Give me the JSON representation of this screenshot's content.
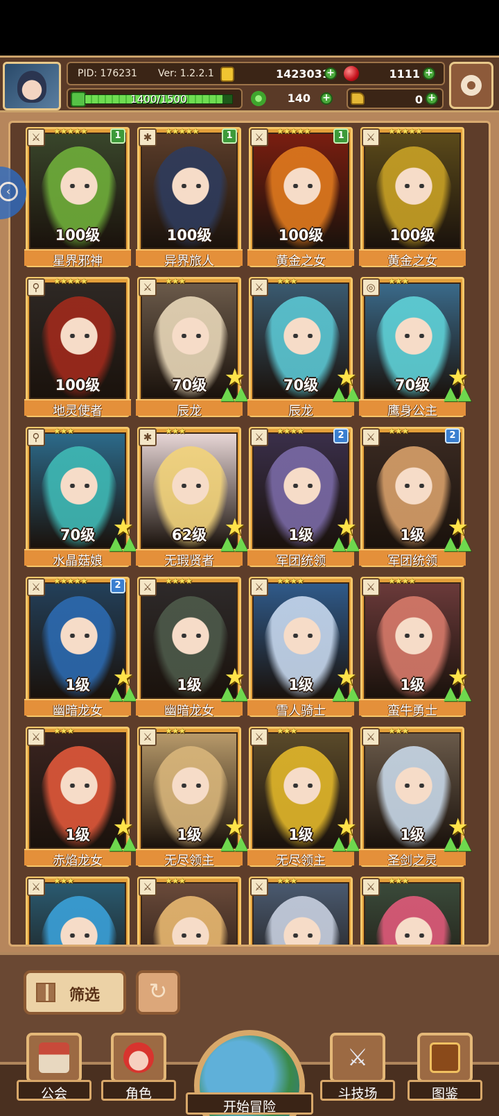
{
  "header": {
    "pid": "PID: 176231",
    "version": "Ver: 1.2.2.1",
    "gold": "1423031",
    "rubies": "1111",
    "exp": "1400/1500",
    "exp_progress": 0.933,
    "clover": "140",
    "keys": "0"
  },
  "side_tab_glyph": "‹",
  "heroes": [
    {
      "name": "星界邪神",
      "level": "100级",
      "stars": "★★★★★",
      "badge": "1",
      "badge_color": "green",
      "class": "sword",
      "hair": "#6fae3a",
      "bg": "#39462b"
    },
    {
      "name": "异界旅人",
      "level": "100级",
      "stars": "★★★★★",
      "badge": "1",
      "badge_color": "green",
      "class": "wheel",
      "hair": "#2e3b5c",
      "bg": "#5b3d2a"
    },
    {
      "name": "黄金之女",
      "level": "100级",
      "stars": "★★★★★",
      "badge": "1",
      "badge_color": "green",
      "class": "sword",
      "hair": "#e07a1e",
      "bg": "#7a1e10"
    },
    {
      "name": "黄金之女",
      "level": "100级",
      "stars": "★★★★★",
      "badge": "",
      "badge_color": "",
      "class": "sword",
      "hair": "#c8a125",
      "bg": "#5b4a1a"
    },
    {
      "name": "地灵使者",
      "level": "100级",
      "stars": "★★★★★",
      "badge": "",
      "badge_color": "",
      "class": "staff",
      "hair": "#a02a1c",
      "bg": "#2e2824"
    },
    {
      "name": "辰龙",
      "level": "70级",
      "stars": "★★★",
      "badge": "",
      "badge_color": "",
      "class": "sword",
      "hair": "#e8d7b8",
      "bg": "#6b5a4a",
      "upgradable": true
    },
    {
      "name": "辰龙",
      "level": "70级",
      "stars": "★★★",
      "badge": "",
      "badge_color": "",
      "class": "sword",
      "hair": "#5bc7d3",
      "bg": "#3a5a70",
      "upgradable": true
    },
    {
      "name": "鹰身公主",
      "level": "70级",
      "stars": "★★★",
      "badge": "",
      "badge_color": "",
      "class": "bow",
      "hair": "#5fd2d8",
      "bg": "#3a6a8a",
      "upgradable": true
    },
    {
      "name": "水晶菇娘",
      "level": "70级",
      "stars": "★★★",
      "badge": "",
      "badge_color": "",
      "class": "staff",
      "hair": "#3fb9b5",
      "bg": "#2c6a8a",
      "upgradable": true
    },
    {
      "name": "无瑕贤者",
      "level": "62级",
      "stars": "★★★",
      "badge": "",
      "badge_color": "",
      "class": "wheel",
      "hair": "#f2d37a",
      "bg": "#e7d6d6",
      "upgradable": true
    },
    {
      "name": "军团统领",
      "level": "1级",
      "stars": "★★★★",
      "badge": "2",
      "badge_color": "blue",
      "class": "sword",
      "hair": "#7a6aa6",
      "bg": "#3a2f4a",
      "upgradable": true
    },
    {
      "name": "军团统领",
      "level": "1级",
      "stars": "★★★",
      "badge": "2",
      "badge_color": "blue",
      "class": "sword",
      "hair": "#d8a06a",
      "bg": "#3a2a22",
      "upgradable": true
    },
    {
      "name": "幽暗龙女",
      "level": "1级",
      "stars": "★★★★★",
      "badge": "2",
      "badge_color": "blue",
      "class": "sword",
      "hair": "#2c6ab0",
      "bg": "#23405a",
      "upgradable": true
    },
    {
      "name": "幽暗龙女",
      "level": "1级",
      "stars": "★★★★",
      "badge": "",
      "badge_color": "",
      "class": "sword",
      "hair": "#4d5a4a",
      "bg": "#2e2a2a",
      "upgradable": true
    },
    {
      "name": "雪人骑士",
      "level": "1级",
      "stars": "★★★★",
      "badge": "",
      "badge_color": "",
      "class": "sword",
      "hair": "#c7d8ee",
      "bg": "#2f5a8a",
      "upgradable": true
    },
    {
      "name": "蛮牛勇士",
      "level": "1级",
      "stars": "★★★★",
      "badge": "",
      "badge_color": "",
      "class": "sword",
      "hair": "#d77a6a",
      "bg": "#6b3a3a",
      "upgradable": true
    },
    {
      "name": "赤焰龙女",
      "level": "1级",
      "stars": "★★★",
      "badge": "",
      "badge_color": "",
      "class": "sword",
      "hair": "#e0583a",
      "bg": "#3a2420",
      "upgradable": true
    },
    {
      "name": "无尽领主",
      "level": "1级",
      "stars": "★★★",
      "badge": "",
      "badge_color": "",
      "class": "sword",
      "hair": "#d8b57a",
      "bg": "#b89a6a",
      "upgradable": true
    },
    {
      "name": "无尽领主",
      "level": "1级",
      "stars": "★★★",
      "badge": "",
      "badge_color": "",
      "class": "sword",
      "hair": "#e2b72a",
      "bg": "#5a4a2a",
      "upgradable": true
    },
    {
      "name": "圣剑之灵",
      "level": "1级",
      "stars": "★★★",
      "badge": "",
      "badge_color": "",
      "class": "sword",
      "hair": "#c8d8e8",
      "bg": "#6a5a4a",
      "upgradable": true
    },
    {
      "name": "",
      "level": "",
      "stars": "★★★",
      "badge": "",
      "badge_color": "",
      "class": "sword",
      "hair": "#3aa0d8",
      "bg": "#2a5a70"
    },
    {
      "name": "",
      "level": "",
      "stars": "★★★",
      "badge": "",
      "badge_color": "",
      "class": "sword",
      "hair": "#e8b870",
      "bg": "#6a4a3a"
    },
    {
      "name": "",
      "level": "",
      "stars": "★★★",
      "badge": "",
      "badge_color": "",
      "class": "sword",
      "hair": "#c8d0e0",
      "bg": "#4a5a70"
    },
    {
      "name": "",
      "level": "",
      "stars": "★★★",
      "badge": "",
      "badge_color": "",
      "class": "sword",
      "hair": "#e05a7a",
      "bg": "#3a4a3a"
    }
  ],
  "filter": {
    "label": "筛选"
  },
  "nav": [
    {
      "label": "公会",
      "icon": "guild-icon"
    },
    {
      "label": "角色",
      "icon": "character-icon"
    },
    {
      "label": "开始冒险",
      "icon": "adventure-icon"
    },
    {
      "label": "斗技场",
      "icon": "arena-icon"
    },
    {
      "label": "图鉴",
      "icon": "codex-icon"
    }
  ]
}
